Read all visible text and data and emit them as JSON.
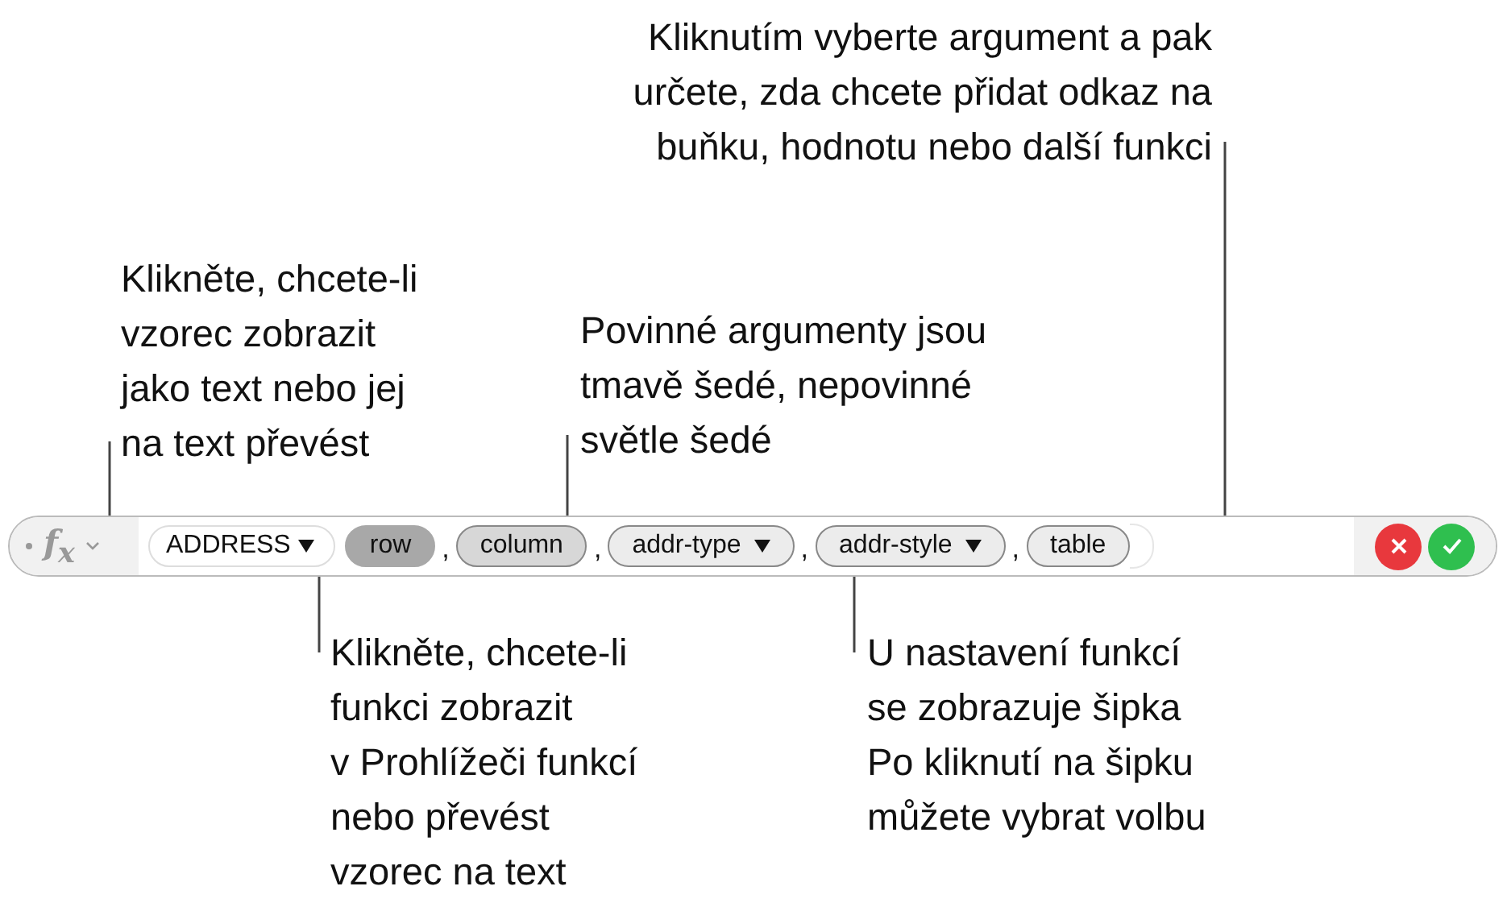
{
  "callouts": [
    {
      "lines": [
        "Kliknutím vyberte argument a pak",
        "určete, zda chcete přidat odkaz na",
        "buňku, hodnotu nebo další funkci"
      ]
    },
    {
      "lines": [
        "Klikněte, chcete-li",
        "vzorec zobrazit",
        "jako text nebo jej",
        "na text převést"
      ]
    },
    {
      "lines": [
        "Povinné argumenty jsou",
        "tmavě šedé, nepovinné",
        "světle šedé"
      ]
    },
    {
      "lines": [
        "Klikněte, chcete-li",
        "funkci zobrazit",
        "v Prohlížeči funkcí",
        "nebo převést",
        "vzorec na text"
      ]
    },
    {
      "lines": [
        "U nastavení funkcí",
        "se zobrazuje šipka",
        "Po kliknutí na šipku",
        "můžete vybrat volbu"
      ]
    }
  ],
  "formula_bar": {
    "fx": "f$_{x}$",
    "function": "ADDRESS",
    "separator": ",",
    "arguments": [
      {
        "label": "row",
        "required": true,
        "selected": true,
        "menu": false
      },
      {
        "label": "column",
        "required": true,
        "selected": false,
        "menu": false
      },
      {
        "label": "addr-type",
        "required": false,
        "selected": false,
        "menu": true
      },
      {
        "label": "addr-style",
        "required": false,
        "selected": false,
        "menu": true
      },
      {
        "label": "table",
        "required": false,
        "selected": false,
        "menu": false
      }
    ]
  }
}
